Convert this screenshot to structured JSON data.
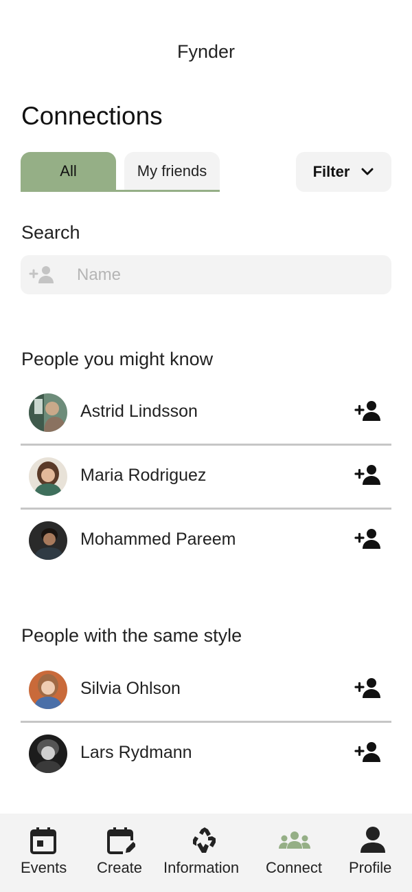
{
  "app": {
    "title": "Fynder"
  },
  "page": {
    "title": "Connections"
  },
  "tabs": [
    {
      "label": "All",
      "active": true
    },
    {
      "label": "My friends",
      "active": false
    }
  ],
  "filter": {
    "label": "Filter"
  },
  "search": {
    "label": "Search",
    "placeholder": "Name",
    "value": ""
  },
  "sections": {
    "might_know": {
      "title": "People you might know",
      "people": [
        {
          "name": "Astrid Lindsson"
        },
        {
          "name": "Maria Rodriguez"
        },
        {
          "name": "Mohammed Pareem"
        }
      ]
    },
    "same_style": {
      "title": "People with the same style",
      "people": [
        {
          "name": "Silvia Ohlson"
        },
        {
          "name": "Lars Rydmann"
        }
      ]
    }
  },
  "nav": [
    {
      "label": "Events",
      "icon": "calendar-icon",
      "active": false
    },
    {
      "label": "Create",
      "icon": "calendar-edit-icon",
      "active": false
    },
    {
      "label": "Information",
      "icon": "recycle-icon",
      "active": false
    },
    {
      "label": "Connect",
      "icon": "group-icon",
      "active": true
    },
    {
      "label": "Profile",
      "icon": "person-icon",
      "active": false
    }
  ],
  "colors": {
    "accent": "#95af86",
    "surface": "#f3f3f3",
    "divider": "#c6c6c6",
    "text": "#222222"
  }
}
